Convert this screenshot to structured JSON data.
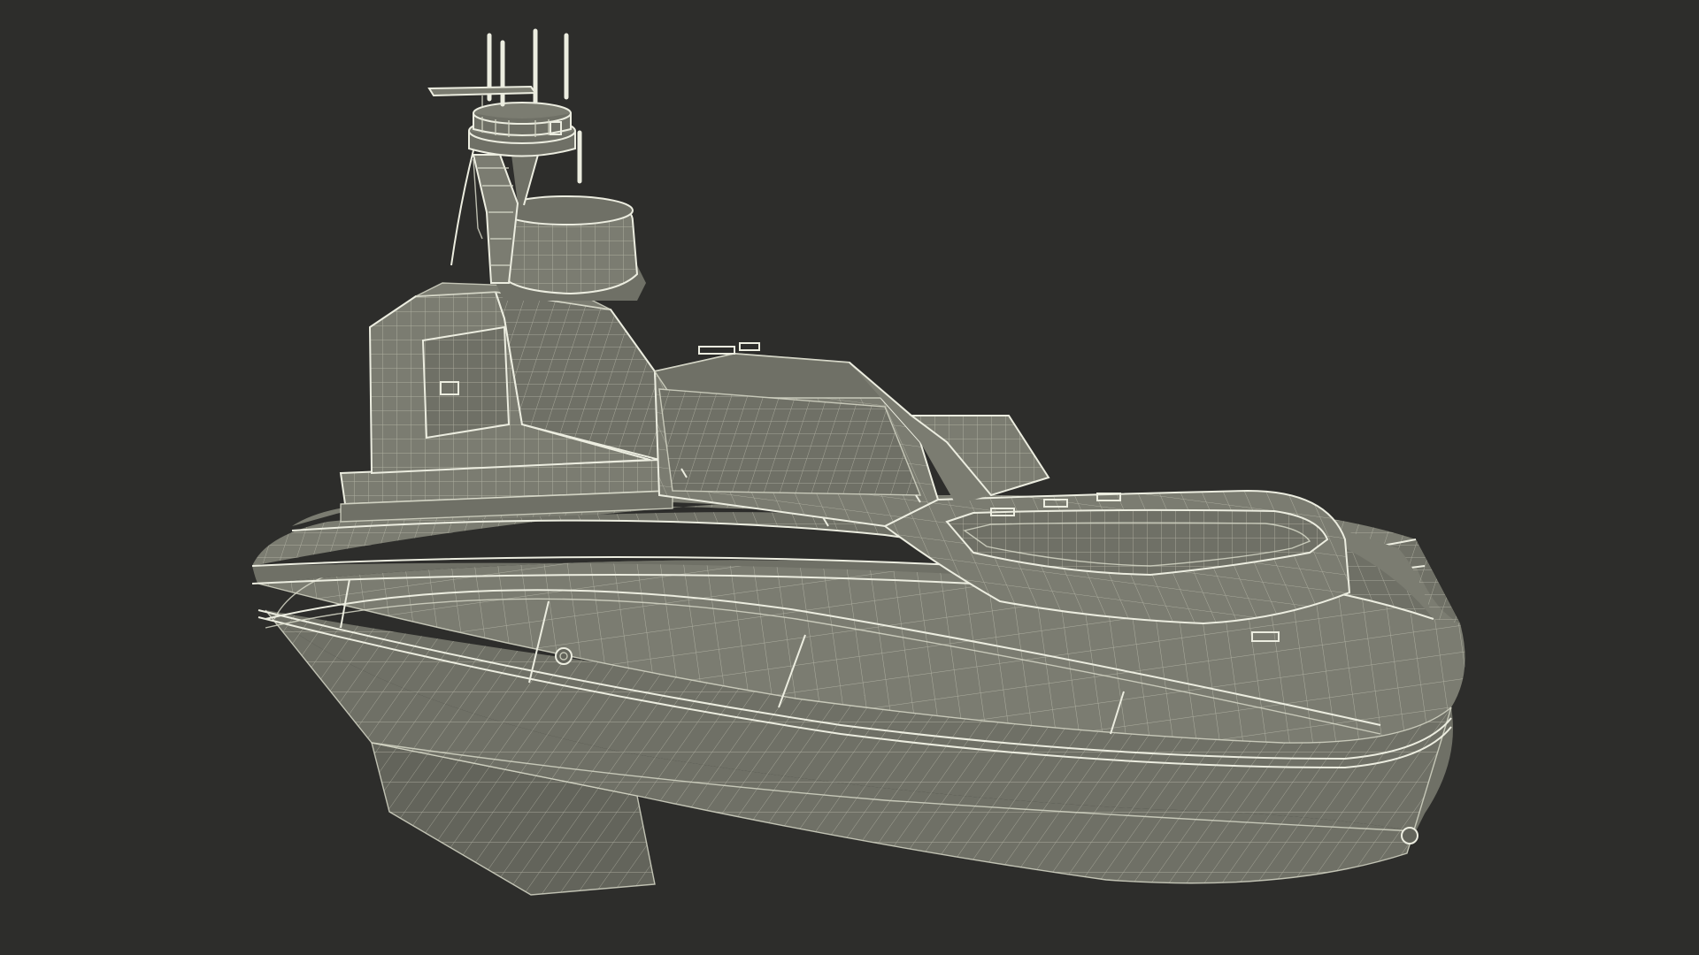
{
  "scene": {
    "subject": "wireframe-unmanned-surface-vessel",
    "colors": {
      "background": "#2d2d2b",
      "surface": "#7b7c71",
      "surface_shade": "#6f7066",
      "surface_dark": "#63645b",
      "wire": "#d6d7c7",
      "wire_strong": "#ecede0"
    }
  }
}
